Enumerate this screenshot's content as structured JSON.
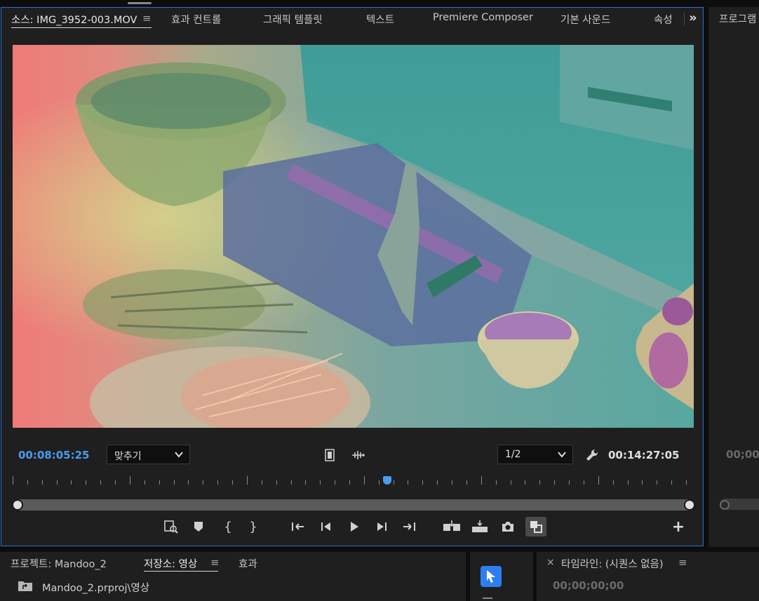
{
  "source_panel": {
    "tabs": [
      {
        "label": "소스: IMG_3952-003.MOV",
        "active": true
      },
      {
        "label": "효과 컨트롤"
      },
      {
        "label": "그래픽 템플릿"
      },
      {
        "label": "텍스트"
      },
      {
        "label": "Premiere Composer"
      },
      {
        "label": "기본 사운드"
      },
      {
        "label": "속성"
      }
    ],
    "overflow_icon": "double-chevron-right-icon",
    "menu_icon": "≡",
    "current_timecode": "00:08:05:25",
    "zoom_select": "맞추기",
    "resolution_select": "1/2",
    "duration_timecode": "00:14:27:05",
    "playhead_fraction": 0.556,
    "controls": [
      "view-preview-icon",
      "add-marker-icon",
      "mark-in-icon",
      "mark-out-icon",
      "go-to-in-icon",
      "step-back-icon",
      "play-icon",
      "step-forward-icon",
      "go-to-out-icon",
      "insert-icon",
      "overwrite-icon",
      "export-frame-icon",
      "toggle-proxies-icon",
      "button-editor-icon"
    ]
  },
  "program_panel": {
    "tab_label": "프로그램",
    "timecode": "00;00"
  },
  "project_panel": {
    "tabs": [
      {
        "label": "프로젝트: Mandoo_2"
      },
      {
        "label": "저장소: 영상",
        "active": true
      },
      {
        "label": "효과"
      }
    ],
    "path": "Mandoo_2.prproj\\영상"
  },
  "timeline_panel": {
    "close_label": "×",
    "title": "타임라인: (시퀀스 없음)",
    "timecode": "00;00;00;00"
  },
  "colors": {
    "accent_blue": "#4a9cf0",
    "panel_bg": "#1f1f1f",
    "focus_border": "#2d6fd0"
  }
}
